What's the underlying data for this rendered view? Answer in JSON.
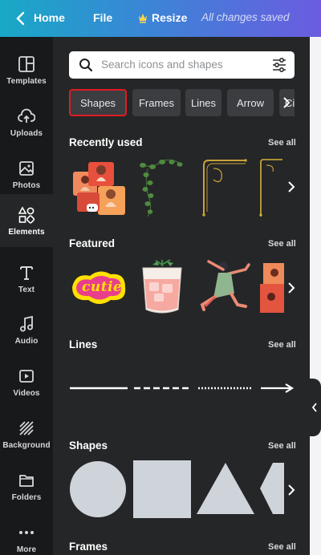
{
  "topbar": {
    "home_label": "Home",
    "file_label": "File",
    "resize_label": "Resize",
    "status_text": "All changes saved"
  },
  "rail": {
    "items": [
      {
        "label": "Templates",
        "icon": "templates-icon"
      },
      {
        "label": "Uploads",
        "icon": "upload-cloud-icon"
      },
      {
        "label": "Photos",
        "icon": "photo-icon"
      },
      {
        "label": "Elements",
        "icon": "elements-icon"
      },
      {
        "label": "Text",
        "icon": "text-icon"
      },
      {
        "label": "Audio",
        "icon": "music-note-icon"
      },
      {
        "label": "Videos",
        "icon": "video-icon"
      },
      {
        "label": "Background",
        "icon": "background-hatch-icon"
      },
      {
        "label": "Folders",
        "icon": "folder-icon"
      },
      {
        "label": "More",
        "icon": "more-dots-icon"
      }
    ],
    "active": "Elements"
  },
  "search": {
    "placeholder": "Search icons and shapes"
  },
  "chips": [
    {
      "label": "Shapes",
      "selected": true
    },
    {
      "label": "Frames",
      "selected": false
    },
    {
      "label": "Lines",
      "selected": false
    },
    {
      "label": "Arrow",
      "selected": false
    },
    {
      "label": "Circle",
      "selected": false
    }
  ],
  "sections": {
    "recently_used": {
      "title": "Recently used",
      "see_all": "See all"
    },
    "featured": {
      "title": "Featured",
      "see_all": "See all",
      "sticker_text": "cutie"
    },
    "lines": {
      "title": "Lines",
      "see_all": "See all"
    },
    "shapes": {
      "title": "Shapes",
      "see_all": "See all"
    },
    "frames": {
      "title": "Frames",
      "see_all": "See all"
    }
  },
  "colors": {
    "highlight_border": "#e01b22",
    "panel_bg": "#252627",
    "rail_bg": "#18191b",
    "shape_fill": "#cfd3da"
  }
}
